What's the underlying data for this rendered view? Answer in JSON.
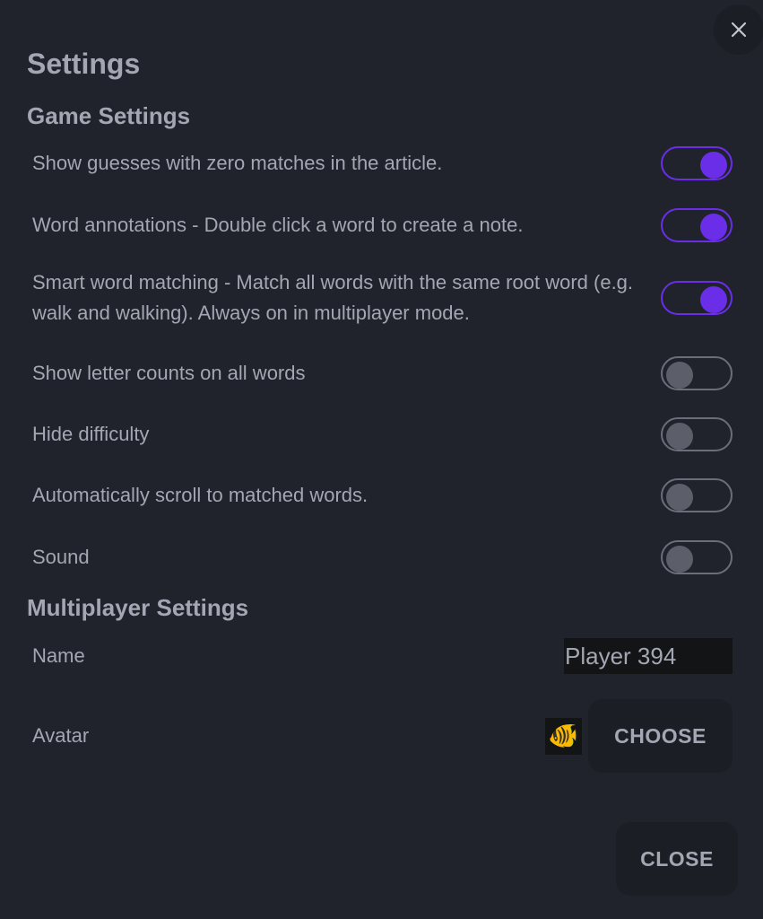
{
  "dialog": {
    "title": "Settings",
    "close_icon": "close-icon"
  },
  "game_settings": {
    "heading": "Game Settings",
    "items": [
      {
        "label": "Show guesses with zero matches in the article.",
        "enabled": true
      },
      {
        "label": "Word annotations - Double click a word to create a note.",
        "enabled": true
      },
      {
        "label": "Smart word matching - Match all words with the same root word (e.g. walk and walking). Always on in multiplayer mode.",
        "enabled": true
      },
      {
        "label": "Show letter counts on all words",
        "enabled": false
      },
      {
        "label": "Hide difficulty",
        "enabled": false
      },
      {
        "label": "Automatically scroll to matched words.",
        "enabled": false
      },
      {
        "label": "Sound",
        "enabled": false
      }
    ]
  },
  "multiplayer_settings": {
    "heading": "Multiplayer Settings",
    "name_label": "Name",
    "name_value": "Player 394",
    "avatar_label": "Avatar",
    "avatar_emoji": "🐠",
    "choose_label": "CHOOSE"
  },
  "footer": {
    "close_label": "CLOSE"
  },
  "colors": {
    "background": "#20232b",
    "accent": "#6a2ee8",
    "toggle_off": "#5c5f69",
    "text": "#a3a7b3",
    "button_bg": "#1b1e25",
    "input_bg": "#131416"
  }
}
